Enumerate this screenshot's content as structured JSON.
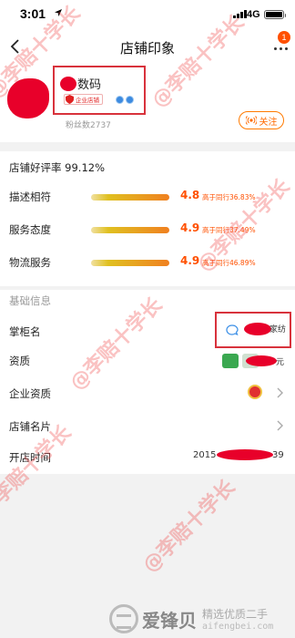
{
  "status_bar": {
    "time": "3:01",
    "network": "4G"
  },
  "nav": {
    "title": "店铺印象",
    "badge_count": "1"
  },
  "shop": {
    "name_visible": "数码",
    "enterprise_badge": "企业店铺",
    "fans_text": "粉丝数2737",
    "follow_label": "关注"
  },
  "rating": {
    "overall": "店铺好评率 99.12%",
    "rows": [
      {
        "label": "描述相符",
        "score": "4.8",
        "compare": "高于同行36.83%"
      },
      {
        "label": "服务态度",
        "score": "4.9",
        "compare": "高于同行37.49%"
      },
      {
        "label": "物流服务",
        "score": "4.9",
        "compare": "高于同行46.89%"
      }
    ]
  },
  "info": {
    "header": "基础信息",
    "manager_label": "掌柜名",
    "manager_suffix": "家纺",
    "qualification_label": "资质",
    "qualification_suffix": "元",
    "enterprise_qual_label": "企业资质",
    "shop_card_label": "店铺名片",
    "opened_label": "开店时间",
    "opened_prefix": "2015",
    "opened_suffix": "39"
  },
  "watermark": "@李赔十学长",
  "brand": {
    "name": "爱锋贝",
    "tagline": "精选优质二手",
    "domain": "aifengbei.com"
  }
}
